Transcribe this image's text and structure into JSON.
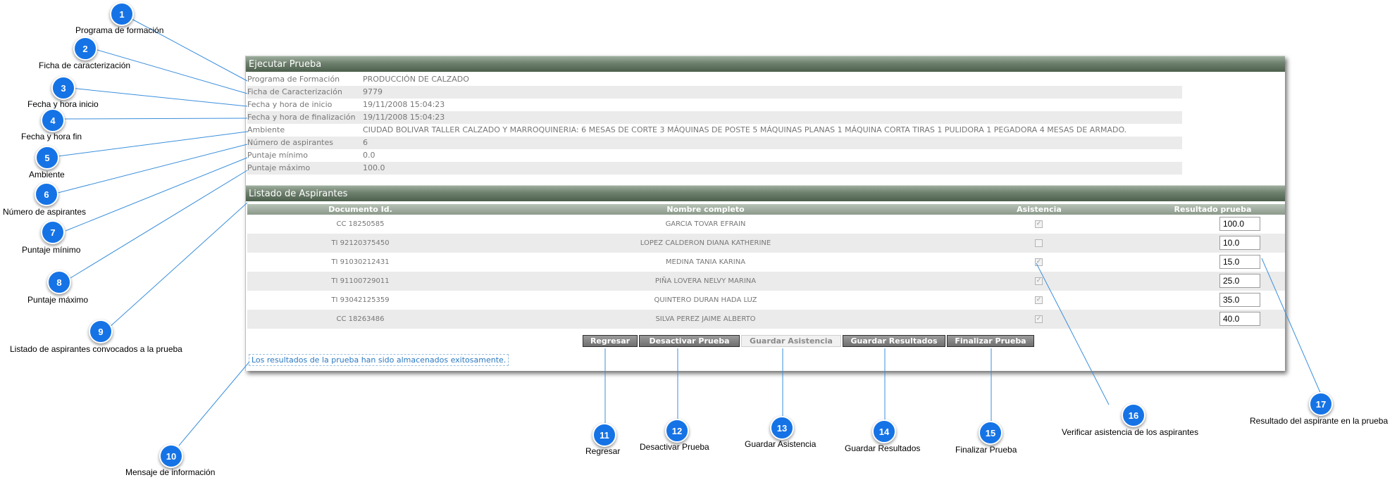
{
  "annotations": [
    {
      "number": "1",
      "caption": "Programa de formación"
    },
    {
      "number": "2",
      "caption": "Ficha de caracterización"
    },
    {
      "number": "3",
      "caption": "Fecha y hora inicio"
    },
    {
      "number": "4",
      "caption": "Fecha y hora fin"
    },
    {
      "number": "5",
      "caption": "Ambiente"
    },
    {
      "number": "6",
      "caption": "Número de aspirantes"
    },
    {
      "number": "7",
      "caption": "Puntaje mínimo"
    },
    {
      "number": "8",
      "caption": "Puntaje máximo"
    },
    {
      "number": "9",
      "caption": "Listado de aspirantes convocados a la prueba"
    },
    {
      "number": "10",
      "caption": "Mensaje de información"
    },
    {
      "number": "11",
      "caption": "Regresar"
    },
    {
      "number": "12",
      "caption": "Desactivar Prueba"
    },
    {
      "number": "13",
      "caption": "Guardar Asistencia"
    },
    {
      "number": "14",
      "caption": "Guardar Resultados"
    },
    {
      "number": "15",
      "caption": "Finalizar Prueba"
    },
    {
      "number": "16",
      "caption": "Verificar asistencia de los aspirantes"
    },
    {
      "number": "17",
      "caption": "Resultado del aspirante en la prueba"
    }
  ],
  "execute_test": {
    "title": "Ejecutar Prueba",
    "rows": [
      {
        "label": "Programa de Formación",
        "value": "PRODUCCIÓN DE CALZADO"
      },
      {
        "label": "Ficha de Caracterización",
        "value": "9779"
      },
      {
        "label": "Fecha y hora de inicio",
        "value": "19/11/2008 15:04:23"
      },
      {
        "label": "Fecha y hora de finalización",
        "value": "19/11/2008 15:04:23"
      },
      {
        "label": "Ambiente",
        "value": "CIUDAD BOLIVAR TALLER CALZADO Y MARROQUINERIA: 6 MESAS DE CORTE 3 MÁQUINAS DE POSTE 5 MÁQUINAS PLANAS 1 MÁQUINA CORTA TIRAS 1 PULIDORA 1 PEGADORA 4 MESAS DE ARMADO."
      },
      {
        "label": "Número de aspirantes",
        "value": "6"
      },
      {
        "label": "Puntaje mínimo",
        "value": "0.0"
      },
      {
        "label": "Puntaje máximo",
        "value": "100.0"
      }
    ]
  },
  "candidates": {
    "title": "Listado de Aspirantes",
    "columns": [
      "Documento Id.",
      "Nombre completo",
      "Asistencia",
      "Resultado prueba"
    ],
    "rows": [
      {
        "doc": "CC 18250585",
        "name": "GARCIA TOVAR EFRAIN",
        "attended": true,
        "result": "100.0"
      },
      {
        "doc": "TI 92120375450",
        "name": "LOPEZ CALDERON DIANA KATHERINE",
        "attended": false,
        "result": "10.0"
      },
      {
        "doc": "TI 91030212431",
        "name": "MEDINA TANIA KARINA",
        "attended": true,
        "result": "15.0"
      },
      {
        "doc": "TI 91100729011",
        "name": "PIÑA LOVERA NELVY MARINA",
        "attended": true,
        "result": "25.0"
      },
      {
        "doc": "TI 93042125359",
        "name": "QUINTERO DURAN HADA LUZ",
        "attended": true,
        "result": "35.0"
      },
      {
        "doc": "CC 18263486",
        "name": "SILVA PEREZ JAIME ALBERTO",
        "attended": true,
        "result": "40.0"
      }
    ]
  },
  "actions": {
    "back": "Regresar",
    "deactivate": "Desactivar Prueba",
    "save_attendance": "Guardar Asistencia",
    "save_results": "Guardar Resultados",
    "finish": "Finalizar Prueba"
  },
  "message": "Los resultados de la prueba han sido almacenados exitosamente."
}
